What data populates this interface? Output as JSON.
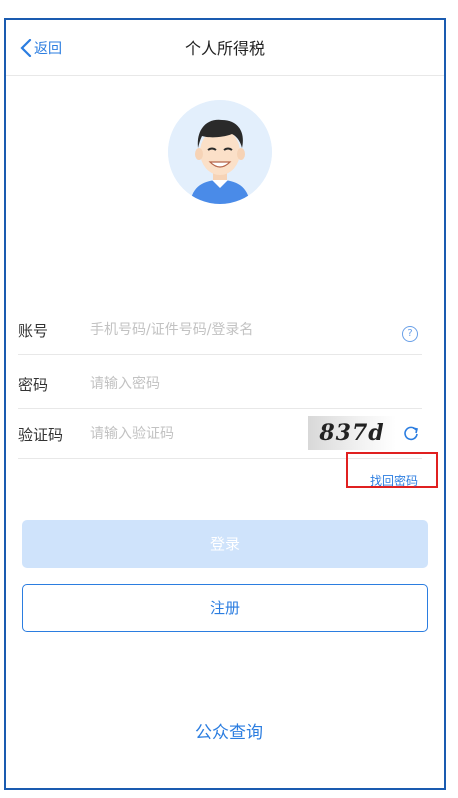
{
  "nav": {
    "back_label": "返回",
    "title": "个人所得税"
  },
  "form": {
    "account": {
      "label": "账号",
      "placeholder": "手机号码/证件号码/登录名"
    },
    "password": {
      "label": "密码",
      "placeholder": "请输入密码"
    },
    "captcha": {
      "label": "验证码",
      "placeholder": "请输入验证码",
      "image_text": "837d"
    }
  },
  "links": {
    "forgot": "找回密码"
  },
  "buttons": {
    "login": "登录",
    "register": "注册"
  },
  "footer": {
    "query": "公众查询"
  },
  "colors": {
    "accent": "#2b7de0",
    "login_disabled": "#cfe3fb",
    "frame": "#1a5bb0",
    "highlight": "#e02020"
  }
}
